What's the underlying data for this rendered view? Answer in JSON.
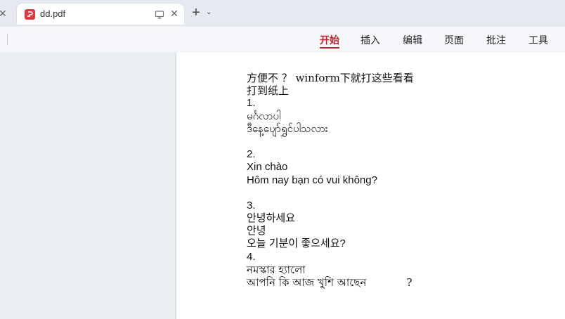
{
  "tabs": {
    "active": {
      "title": "dd.pdf",
      "icon": "pdf-icon",
      "icon_color": "#e0383e"
    },
    "prev_close_icon": "close-icon",
    "tab_close_icon": "close-icon",
    "new_tab_icon": "plus-icon",
    "dropdown_icon": "chevron-down-icon",
    "monitor_icon": "monitor-icon"
  },
  "menu": {
    "items": [
      {
        "label": "开始",
        "active": true
      },
      {
        "label": "插入",
        "active": false
      },
      {
        "label": "编辑",
        "active": false
      },
      {
        "label": "页面",
        "active": false
      },
      {
        "label": "批注",
        "active": false
      },
      {
        "label": "工具",
        "active": false
      }
    ],
    "accent_color": "#c4202a"
  },
  "document": {
    "lines": [
      "方便不 ？ winform下就打这些看看",
      "打到纸上",
      "1.",
      "မင်္ဂလာပါ",
      "ဒီနေ့ပျော်ရွှင်ပါသလား",
      "",
      "2.",
      "Xin chào",
      "Hôm nay bạn có vui không?",
      "",
      "3.",
      "안녕하세요",
      "안녕",
      "오늘 기분이 좋으세요?",
      "4.",
      "নমস্কার হ্যালো",
      "আপনি কি আজ খুশি আছেন            ?"
    ]
  }
}
